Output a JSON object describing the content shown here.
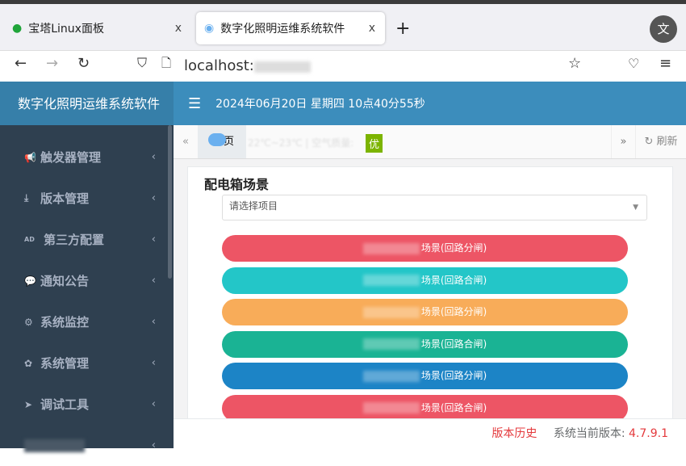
{
  "browser": {
    "tabs": [
      {
        "title": "宝塔Linux面板"
      },
      {
        "title": "数字化照明运维系统软件"
      }
    ],
    "close": "x",
    "new_tab": "+",
    "translate": "文",
    "url": "localhost:"
  },
  "sidebar": {
    "brand": "数字化照明运维系统软件",
    "items": [
      {
        "icon": "bullhorn-icon",
        "glyph": "📢",
        "label": "触发器管理"
      },
      {
        "icon": "download-icon",
        "glyph": "⤓",
        "label": "版本管理"
      },
      {
        "icon": "ad-icon",
        "glyph": "AD",
        "label": "第三方配置"
      },
      {
        "icon": "comment-icon",
        "glyph": "💬",
        "label": "通知公告"
      },
      {
        "icon": "cogs-icon",
        "glyph": "⚙",
        "label": "系统监控"
      },
      {
        "icon": "gear-icon",
        "glyph": "✿",
        "label": "系统管理"
      },
      {
        "icon": "paper-plane-icon",
        "glyph": "➤",
        "label": "调试工具"
      },
      {
        "icon": "blurred-icon",
        "glyph": "",
        "label": ""
      }
    ],
    "chevron": "‹"
  },
  "header": {
    "datetime": "2024年06月20日 星期四 10点40分55秒"
  },
  "tabsrow": {
    "home": "页",
    "weather": "22℃~23℃ | 空气质量:",
    "air_quality": "优",
    "refresh": "刷新"
  },
  "card": {
    "title": "配电箱场景",
    "select_placeholder": "请选择项目",
    "buttons": [
      {
        "label": "场景(回路分闸)",
        "color": "#ed5565"
      },
      {
        "label": "场景(回路合闸)",
        "color": "#23c6c8"
      },
      {
        "label": "场景(回路分闸)",
        "color": "#f8ac59"
      },
      {
        "label": "场景(回路合闸)",
        "color": "#1ab394"
      },
      {
        "label": "场景(回路分闸)",
        "color": "#1c84c6"
      },
      {
        "label": "场景(回路合闸)",
        "color": "#ed5565"
      }
    ]
  },
  "footer": {
    "history": "版本历史",
    "version_label": "系统当前版本:",
    "version": "4.7.9.1"
  }
}
